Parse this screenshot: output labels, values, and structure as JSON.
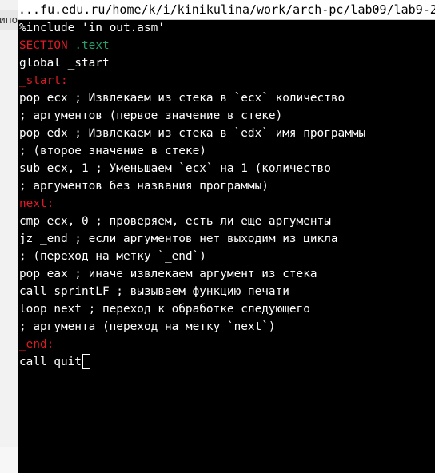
{
  "background_window": {
    "menu_fragment": "Кипо"
  },
  "terminal": {
    "title": "...fu.edu.ru/home/k/i/kinikulina/work/arch-pc/lab09/lab9-2",
    "lines": [
      "%include 'in_out.asm'",
      "SECTION",
      ".text",
      "global _start",
      "_start:",
      "pop ecx ; Извлекаем из стека в `ecx` количество",
      "; аргументов (первое значение в стеке)",
      "pop edx ; Извлекаем из стека в `edx` имя программы",
      "; (второе значение в стеке)",
      "sub ecx, 1 ; Уменьшаем `ecx` на 1 (количество",
      "; аргументов без названия программы)",
      "next:",
      "cmp ecx, 0 ; проверяем, есть ли еще аргументы",
      "jz _end ; если аргументов нет выходим из цикла",
      "; (переход на метку `_end`)",
      "pop eax ; иначе извлекаем аргумент из стека",
      "call sprintLF ; вызываем функцию печати",
      "loop next ; переход к обработке следующего",
      "; аргумента (переход на метку `next`)",
      "_end:",
      "call quit"
    ]
  },
  "colors": {
    "background": "#000000",
    "text": "#ffffff",
    "keyword_red": "#e01b24",
    "keyword_green": "#26a269"
  }
}
